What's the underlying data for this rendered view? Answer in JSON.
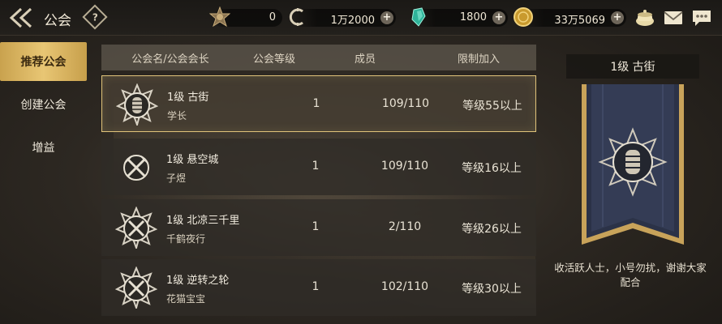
{
  "header": {
    "title": "公会",
    "help_label": "?"
  },
  "resources": [
    {
      "name": "stamina",
      "value": "0",
      "icon": "bronze-medal-icon",
      "has_plus": false
    },
    {
      "name": "coin",
      "value": "1万2000",
      "icon": "c-coin-icon",
      "has_plus": true
    },
    {
      "name": "gem",
      "value": "1800",
      "icon": "green-crystal-icon",
      "has_plus": true
    },
    {
      "name": "gold",
      "value": "33万5069",
      "icon": "gold-coin-icon",
      "has_plus": true
    }
  ],
  "plus_label": "+",
  "nav": {
    "items": [
      {
        "label": "推荐公会",
        "active": true
      },
      {
        "label": "创建公会",
        "active": false
      },
      {
        "label": "增益",
        "active": false
      }
    ]
  },
  "table": {
    "headers": {
      "name": "公会名/公会会长",
      "level": "公会等级",
      "members": "成员",
      "limit": "限制加入"
    },
    "rows": [
      {
        "name": "1级 古街",
        "leader": "学长",
        "level": "1",
        "members": "109/110",
        "limit": "等级55以上",
        "emblem": "lion-star-emblem-icon",
        "selected": true
      },
      {
        "name": "1级 悬空城",
        "leader": "子煜",
        "level": "1",
        "members": "109/110",
        "limit": "等级16以上",
        "emblem": "crossed-swords-emblem-icon",
        "selected": false
      },
      {
        "name": "1级 北凉三千里",
        "leader": "千鹤夜行",
        "level": "1",
        "members": "2/110",
        "limit": "等级26以上",
        "emblem": "crossed-swords-star-emblem-icon",
        "selected": false
      },
      {
        "name": "1级 逆转之轮",
        "leader": "花猫宝宝",
        "level": "1",
        "members": "102/110",
        "limit": "等级30以上",
        "emblem": "crossed-swords-star-emblem-icon",
        "selected": false
      }
    ]
  },
  "detail": {
    "title": "1级 古街",
    "description": "收活跃人士，小号勿扰，谢谢大家配合"
  },
  "colors": {
    "accent_gold": "#e0c37a",
    "nav_active": "#e8c674",
    "banner_blue": "#2b3247"
  }
}
